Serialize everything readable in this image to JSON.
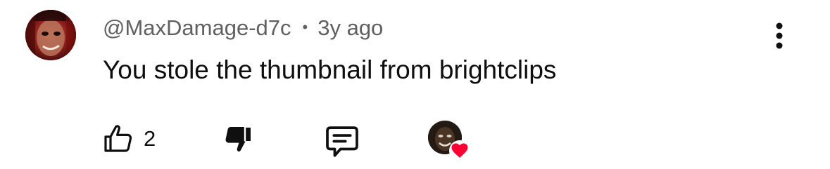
{
  "comment": {
    "author": "@MaxDamage-d7c",
    "separator": "•",
    "time_ago": "3y ago",
    "text": "You stole the thumbnail from brightclips"
  },
  "actions": {
    "like_count": "2"
  },
  "icons": {
    "more": "more-vert-icon",
    "like": "thumbs-up-outline-icon",
    "dislike": "thumbs-down-filled-icon",
    "reply": "reply-comment-icon",
    "heart": "heart-icon"
  },
  "colors": {
    "text_primary": "#0f0f0f",
    "text_secondary": "#606060",
    "heart": "#ff0033"
  }
}
